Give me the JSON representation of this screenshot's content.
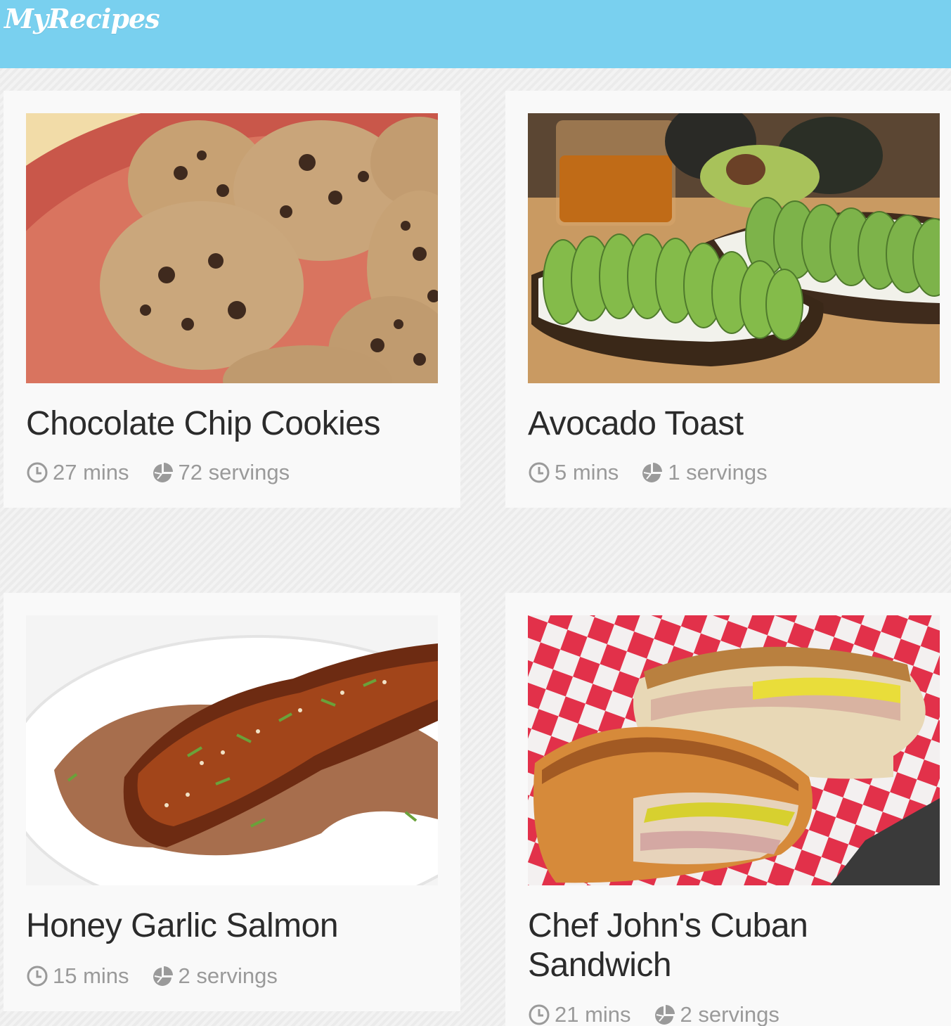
{
  "app": {
    "logo_text": "MyRecipes"
  },
  "colors": {
    "header": "#79d0ef",
    "card": "#f9f9f9",
    "title": "#2b2b2b",
    "meta": "#9a9a9a"
  },
  "recipes": [
    {
      "title": "Chocolate Chip Cookies",
      "time": "27 mins",
      "servings": "72 servings",
      "image": "chocolate-chip-cookies-photo"
    },
    {
      "title": "Avocado Toast",
      "time": "5 mins",
      "servings": "1 servings",
      "image": "avocado-toast-photo"
    },
    {
      "title": "Honey Garlic Salmon",
      "time": "15 mins",
      "servings": "2 servings",
      "image": "honey-garlic-salmon-photo"
    },
    {
      "title": "Chef John's Cuban Sandwich",
      "time": "21 mins",
      "servings": "2 servings",
      "image": "cuban-sandwich-photo"
    }
  ]
}
